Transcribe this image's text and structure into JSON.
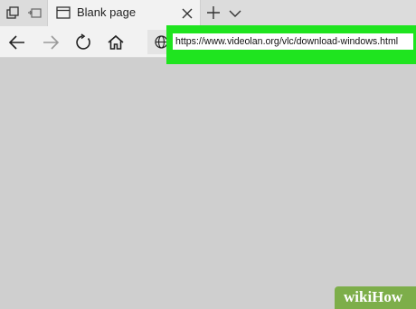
{
  "tabs": [
    {
      "label": "Blank page",
      "active": true,
      "icon": "page-icon"
    }
  ],
  "tabstrip": {
    "icons": [
      "tab-preview-icon",
      "set-aside-tabs-icon",
      "new-tab-icon",
      "tab-list-chevron-icon",
      "close-icon"
    ]
  },
  "navbar": {
    "icons": [
      "back-arrow-icon",
      "forward-arrow-icon",
      "refresh-icon",
      "home-icon",
      "globe-icon"
    ]
  },
  "address_bar": {
    "value": "https://www.videolan.org/vlc/download-windows.html",
    "highlight_color": "#1fe41f"
  },
  "watermark": {
    "text": "wikiHow",
    "color": "#7dae4a"
  },
  "colors": {
    "page_background": "#cfcfcf",
    "chrome_background": "#f2f2f2"
  }
}
